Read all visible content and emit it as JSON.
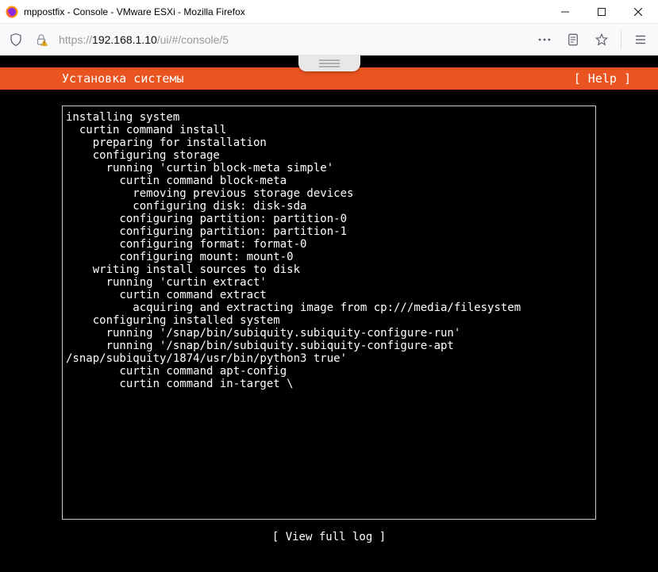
{
  "window": {
    "title": "mppostfix - Console - VMware ESXi - Mozilla Firefox"
  },
  "url": {
    "prefix": "https://",
    "host": "192.168.1.10",
    "path": "/ui/#/console/5"
  },
  "installer": {
    "header_title": "Установка системы",
    "help_label": "[ Help ]",
    "view_log_label": "[ View full log ]",
    "log": "installing system\n  curtin command install\n    preparing for installation\n    configuring storage\n      running 'curtin block-meta simple'\n        curtin command block-meta\n          removing previous storage devices\n          configuring disk: disk-sda\n        configuring partition: partition-0\n        configuring partition: partition-1\n        configuring format: format-0\n        configuring mount: mount-0\n    writing install sources to disk\n      running 'curtin extract'\n        curtin command extract\n          acquiring and extracting image from cp:///media/filesystem\n    configuring installed system\n      running '/snap/bin/subiquity.subiquity-configure-run'\n      running '/snap/bin/subiquity.subiquity-configure-apt\n/snap/subiquity/1874/usr/bin/python3 true'\n        curtin command apt-config\n        curtin command in-target \\"
  }
}
